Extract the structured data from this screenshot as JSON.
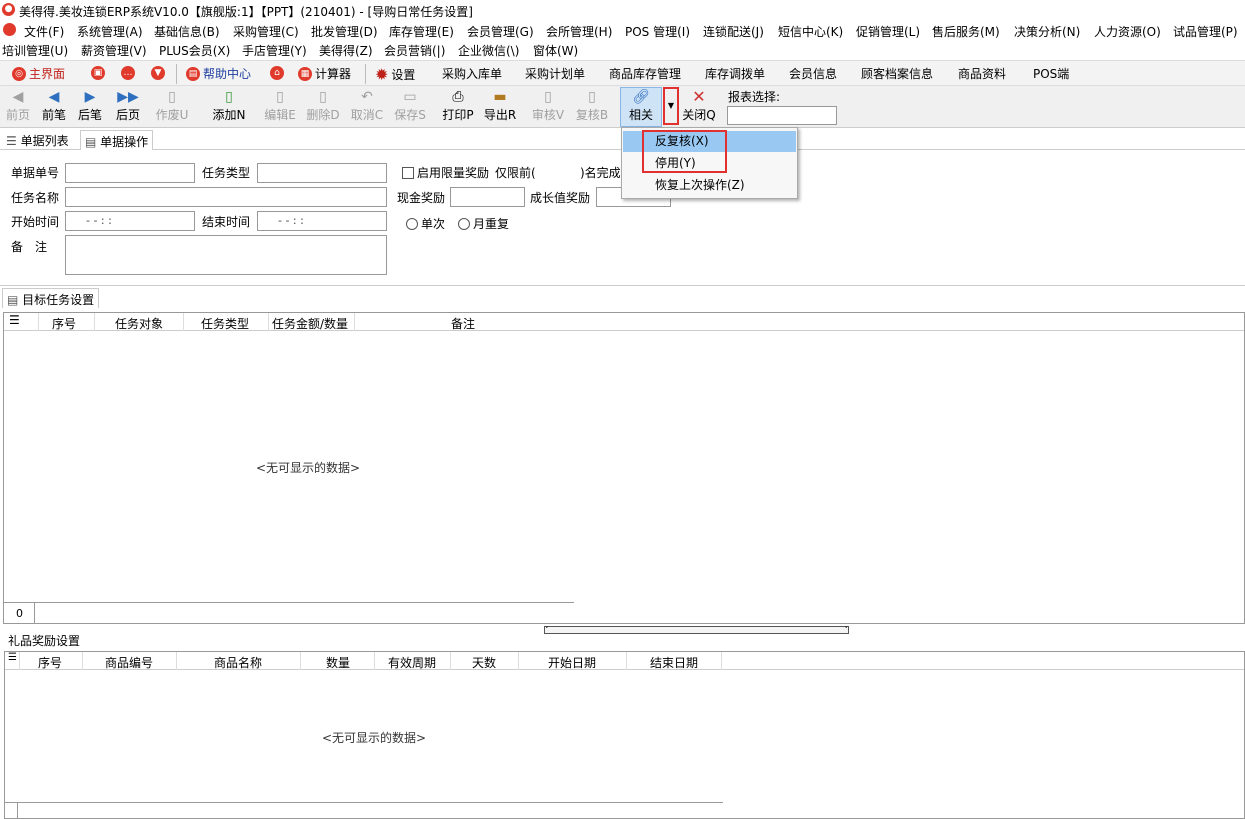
{
  "window": {
    "title": "美得得.美妆连锁ERP系统V10.0【旗舰版:1】【PPT】(210401) - [导购日常任务设置]"
  },
  "menu": [
    "文件(F)",
    "系统管理(A)",
    "基础信息(B)",
    "采购管理(C)",
    "批发管理(D)",
    "库存管理(E)",
    "会员管理(G)",
    "会所管理(H)",
    "POS 管理(I)",
    "连锁配送(J)",
    "短信中心(K)",
    "促销管理(L)",
    "售后服务(M)",
    "决策分析(N)",
    "人力资源(O)",
    "试品管理(P)",
    "培训管理(U)",
    "薪资管理(V)",
    "PLUS会员(X)",
    "手店管理(Y)",
    "美得得(Z)",
    "会员营销(|)",
    "企业微信(\\)",
    "窗体(W)"
  ],
  "quickbar": [
    "主界面",
    "帮助中心",
    "计算器",
    "设置",
    "采购入库单",
    "采购计划单",
    "商品库存管理",
    "库存调拨单",
    "会员信息",
    "顾客档案信息",
    "商品资料",
    "POS端"
  ],
  "toolbar": [
    "前页",
    "前笔",
    "后笔",
    "后页",
    "作废U",
    "添加N",
    "编辑E",
    "删除D",
    "取消C",
    "保存S",
    "打印P",
    "导出R",
    "审核V",
    "复核B",
    "相关",
    "关闭Q"
  ],
  "report": {
    "label": "报表选择:",
    "value": ""
  },
  "tabs": [
    "单据列表",
    "单据操作"
  ],
  "form": {
    "doc_no_label": "单据单号",
    "task_type_label": "任务类型",
    "enable_limit_label": "启用限量奖励",
    "only_before_label": "仅限前(",
    "finish_label": ")名完成",
    "task_name_label": "任务名称",
    "cash_reward_label": "现金奖励",
    "growth_reward_label": "成长值奖励",
    "start_time_label": "开始时间",
    "end_time_label": "结束时间",
    "start_time_value": "-  -      :  :",
    "end_time_value": "-  -      :  :",
    "once_label": "单次",
    "monthly_label": "月重复",
    "remark_label": "备　注"
  },
  "target_section": {
    "title": "目标任务设置",
    "columns": [
      "序号",
      "任务对象",
      "任务类型",
      "任务金额/数量",
      "备注"
    ],
    "empty_text": "<无可显示的数据>",
    "footer_count": "0"
  },
  "gift_section": {
    "title": "礼品奖励设置",
    "columns": [
      "序号",
      "商品编号",
      "商品名称",
      "数量",
      "有效周期",
      "天数",
      "开始日期",
      "结束日期"
    ],
    "empty_text": "<无可显示的数据>"
  },
  "dropdown": [
    "反复核(X)",
    "停用(Y)",
    "恢复上次操作(Z)"
  ]
}
